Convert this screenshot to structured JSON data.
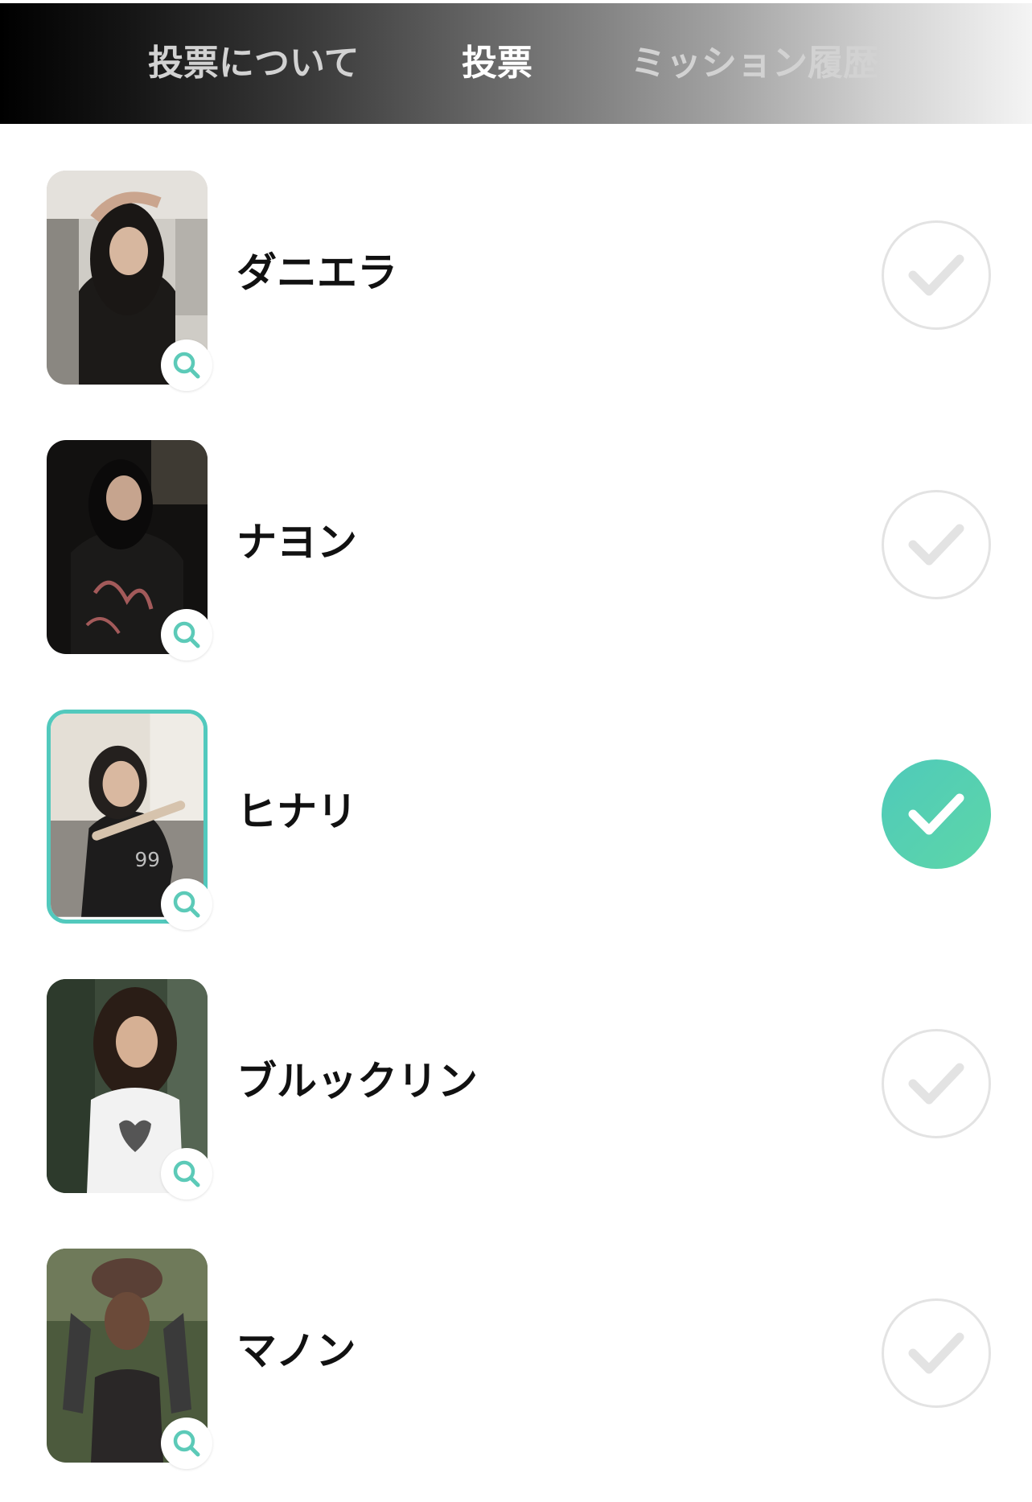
{
  "tabs": [
    {
      "label": "投票について",
      "active": false
    },
    {
      "label": "投票",
      "active": true
    },
    {
      "label": "ミッション履歴",
      "active": false
    }
  ],
  "candidates": [
    {
      "name": "ダニエラ",
      "selected": false
    },
    {
      "name": "ナヨン",
      "selected": false
    },
    {
      "name": "ヒナリ",
      "selected": true
    },
    {
      "name": "ブルックリン",
      "selected": false
    },
    {
      "name": "マノン",
      "selected": false
    }
  ],
  "icons": {
    "zoom": "search-icon",
    "check": "checkmark-icon"
  },
  "colors": {
    "accent": "#52c9bd",
    "check_on_start": "#4fcaba",
    "check_on_end": "#5dd6a8",
    "check_off": "#e3e3e3"
  }
}
